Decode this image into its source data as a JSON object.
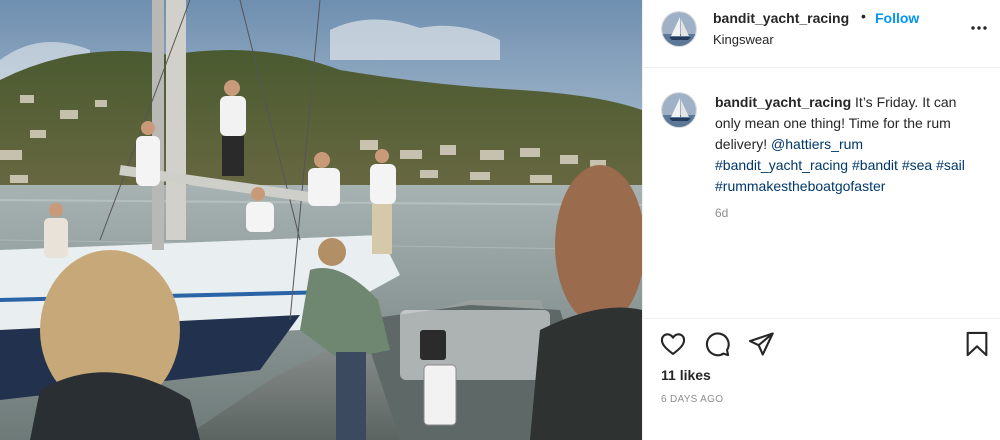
{
  "post": {
    "username": "bandit_yacht_racing",
    "follow_label": "Follow",
    "dot": "•",
    "location": "Kingswear",
    "caption": {
      "username": "bandit_yacht_racing",
      "text": " It’s Friday. It can only mean one thing! Time for the rum delivery! ",
      "mention": "@hattiers_rum",
      "hashtags": [
        "#bandit_yacht_racing",
        "#bandit",
        "#sea",
        "#sail",
        "#rummakestheboatgofaster"
      ]
    },
    "age": "6d",
    "likes": "11 likes",
    "date": "6 DAYS AGO"
  },
  "icons": {
    "more": "more-options-icon",
    "like": "heart-icon",
    "comment": "comment-icon",
    "share": "paper-plane-icon",
    "save": "bookmark-icon"
  },
  "colors": {
    "link_blue": "#0095f6",
    "hashtag_blue": "#00376b",
    "text": "#262626",
    "muted": "#8e8e8e",
    "border": "#efefef"
  }
}
